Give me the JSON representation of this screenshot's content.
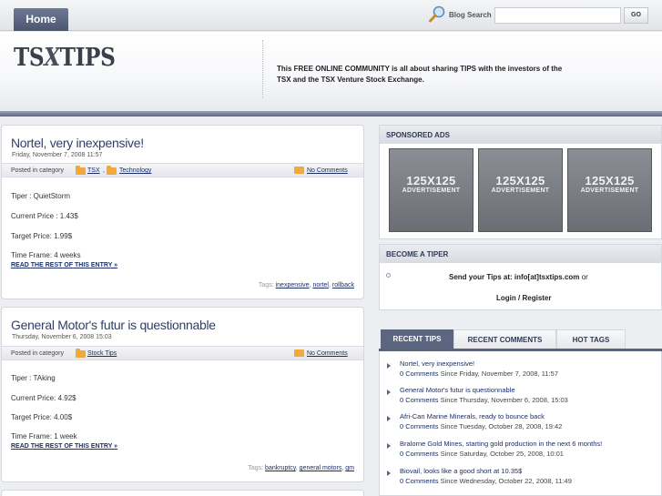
{
  "nav": {
    "home_label": "Home"
  },
  "search": {
    "label": "Blog Search",
    "value": "",
    "placeholder": "",
    "go_label": "GO"
  },
  "header": {
    "logo_left": "TS",
    "logo_x": "X",
    "logo_right": "TIPS",
    "tagline": "This FREE ONLINE COMMUNITY is all about sharing TIPS with the investors of the TSX and the TSX Venture Stock Exchange."
  },
  "posts": [
    {
      "title": "Nortel, very inexpensive!",
      "date": "Friday, November 7, 2008 11:57",
      "posted_in": "Posted in category",
      "categories": [
        "TSX",
        "Technology"
      ],
      "cat_sep": ",",
      "comments": "No Comments",
      "fields": [
        "Tiper : QuietStorm",
        "Current Price : 1.43$",
        "Target Price: 1.99$",
        "Time Frame: 4 weeks"
      ],
      "read_more": "READ THE REST OF THIS ENTRY »",
      "tags_label": "Tags:",
      "tags": [
        "inexpensive",
        "nortel",
        "rollback"
      ]
    },
    {
      "title": "General Motor's futur is questionnable",
      "date": "Thursday, November 6, 2008 15:03",
      "posted_in": "Posted in category",
      "categories": [
        "Stock Tips"
      ],
      "comments": "No Comments",
      "fields": [
        "Tiper : TAking",
        "Current Price: 4.92$",
        "Target Price: 4.00$",
        "Time Frame: 1 week"
      ],
      "read_more": "READ THE REST OF THIS ENTRY »",
      "tags_label": "Tags:",
      "tags": [
        "bankruptcy",
        "general motors",
        "gm"
      ]
    }
  ],
  "sidebar": {
    "sponsored_title": "SPONSORED ADS",
    "ads": [
      {
        "size": "125X125",
        "word": "ADVERTISEMENT"
      },
      {
        "size": "125X125",
        "word": "ADVERTISEMENT"
      },
      {
        "size": "125X125",
        "word": "ADVERTISEMENT"
      }
    ],
    "tiper_title": "BECOME A TIPER",
    "send_tips": "Send your Tips at: info[at]tsxtips.com",
    "send_or": "or",
    "login": "Login",
    "slash": "/",
    "register": "Register",
    "tabs": [
      "RECENT TIPS",
      "RECENT COMMENTS",
      "HOT TAGS"
    ],
    "recent": [
      {
        "title": "Nortel, very inexpensive!",
        "comments": "0 Comments",
        "since": "Since Friday, November 7, 2008, 11:57"
      },
      {
        "title": "General Motor's futur is questionnable",
        "comments": "0 Comments",
        "since": "Since Thursday, November 6, 2008, 15:03"
      },
      {
        "title": "Afri-Can Marine Minerals, ready to bounce back",
        "comments": "0 Comments",
        "since": "Since Tuesday, October 28, 2008, 19:42"
      },
      {
        "title": "Bralorne Gold Mines, starting gold production in the next 6 months!",
        "comments": "0 Comments",
        "since": "Since Saturday, October 25, 2008, 10:01"
      },
      {
        "title": "Biovail, looks like a good short at 10.35$",
        "comments": "0 Comments",
        "since": "Since Wednesday, October 22, 2008, 11:49"
      }
    ]
  },
  "colors": {
    "accent": "#59637e",
    "link": "#1c2f66",
    "folder": "#f2a93b"
  }
}
